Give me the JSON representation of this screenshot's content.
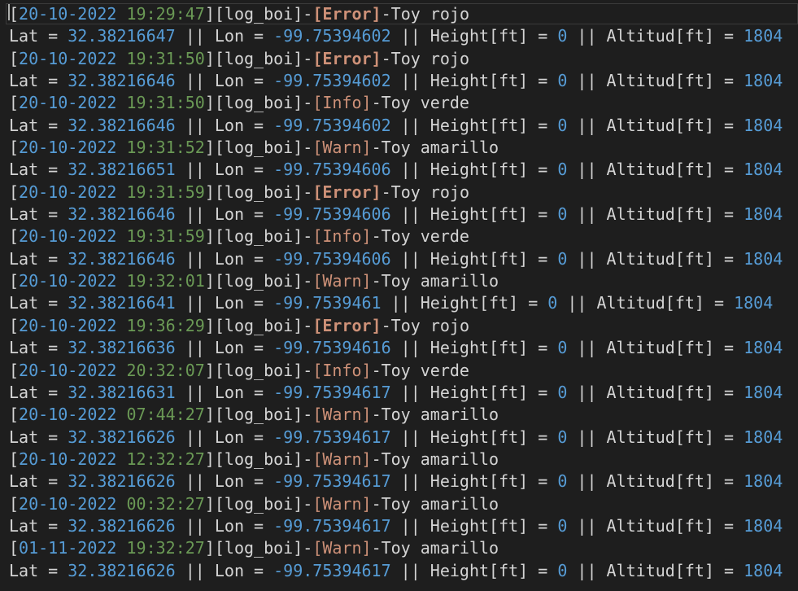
{
  "colors": {
    "background": "#1e1e1e",
    "text": "#d4d4d4",
    "date": "#569cd6",
    "time": "#6a9955",
    "number": "#569cd6",
    "level": "#ce9178",
    "current_line_border": "#3a3a3a",
    "cursor": "#aeafad"
  },
  "log": [
    {
      "header": {
        "date": "20-10-2022",
        "time": "19:29:47",
        "source": "[log_boi]",
        "level": "[Error]",
        "message": "-Toy rojo"
      },
      "data": {
        "lat_label": "Lat = ",
        "lat": "32.38216647",
        "lon_label": " || Lon = ",
        "lon": "-99.75394602",
        "height_label": " || Height[ft] = ",
        "height": "0",
        "alt_label": " || Altitud[ft] = ",
        "alt": "1804"
      }
    },
    {
      "header": {
        "date": "20-10-2022",
        "time": "19:31:50",
        "source": "[log_boi]",
        "level": "[Error]",
        "message": "-Toy rojo"
      },
      "data": {
        "lat_label": "Lat = ",
        "lat": "32.38216646",
        "lon_label": " || Lon = ",
        "lon": "-99.75394602",
        "height_label": " || Height[ft] = ",
        "height": "0",
        "alt_label": " || Altitud[ft] = ",
        "alt": "1804"
      }
    },
    {
      "header": {
        "date": "20-10-2022",
        "time": "19:31:50",
        "source": "[log_boi]",
        "level": "[Info]",
        "message": "-Toy verde"
      },
      "data": {
        "lat_label": "Lat = ",
        "lat": "32.38216646",
        "lon_label": " || Lon = ",
        "lon": "-99.75394602",
        "height_label": " || Height[ft] = ",
        "height": "0",
        "alt_label": " || Altitud[ft] = ",
        "alt": "1804"
      }
    },
    {
      "header": {
        "date": "20-10-2022",
        "time": "19:31:52",
        "source": "[log_boi]",
        "level": "[Warn]",
        "message": "-Toy amarillo"
      },
      "data": {
        "lat_label": "Lat = ",
        "lat": "32.38216651",
        "lon_label": " || Lon = ",
        "lon": "-99.75394606",
        "height_label": " || Height[ft] = ",
        "height": "0",
        "alt_label": " || Altitud[ft] = ",
        "alt": "1804"
      }
    },
    {
      "header": {
        "date": "20-10-2022",
        "time": "19:31:59",
        "source": "[log_boi]",
        "level": "[Error]",
        "message": "-Toy rojo"
      },
      "data": {
        "lat_label": "Lat = ",
        "lat": "32.38216646",
        "lon_label": " || Lon = ",
        "lon": "-99.75394606",
        "height_label": " || Height[ft] = ",
        "height": "0",
        "alt_label": " || Altitud[ft] = ",
        "alt": "1804"
      }
    },
    {
      "header": {
        "date": "20-10-2022",
        "time": "19:31:59",
        "source": "[log_boi]",
        "level": "[Info]",
        "message": "-Toy verde"
      },
      "data": {
        "lat_label": "Lat = ",
        "lat": "32.38216646",
        "lon_label": " || Lon = ",
        "lon": "-99.75394606",
        "height_label": " || Height[ft] = ",
        "height": "0",
        "alt_label": " || Altitud[ft] = ",
        "alt": "1804"
      }
    },
    {
      "header": {
        "date": "20-10-2022",
        "time": "19:32:01",
        "source": "[log_boi]",
        "level": "[Warn]",
        "message": "-Toy amarillo"
      },
      "data": {
        "lat_label": "Lat = ",
        "lat": "32.38216641",
        "lon_label": " || Lon = ",
        "lon": "-99.7539461",
        "height_label": " || Height[ft] = ",
        "height": "0",
        "alt_label": " || Altitud[ft] = ",
        "alt": "1804"
      }
    },
    {
      "header": {
        "date": "20-10-2022",
        "time": "19:36:29",
        "source": "[log_boi]",
        "level": "[Error]",
        "message": "-Toy rojo"
      },
      "data": {
        "lat_label": "Lat = ",
        "lat": "32.38216636",
        "lon_label": " || Lon = ",
        "lon": "-99.75394616",
        "height_label": " || Height[ft] = ",
        "height": "0",
        "alt_label": " || Altitud[ft] = ",
        "alt": "1804"
      }
    },
    {
      "header": {
        "date": "20-10-2022",
        "time": "20:32:07",
        "source": "[log_boi]",
        "level": "[Info]",
        "message": "-Toy verde"
      },
      "data": {
        "lat_label": "Lat = ",
        "lat": "32.38216631",
        "lon_label": " || Lon = ",
        "lon": "-99.75394617",
        "height_label": " || Height[ft] = ",
        "height": "0",
        "alt_label": " || Altitud[ft] = ",
        "alt": "1804"
      }
    },
    {
      "header": {
        "date": "20-10-2022",
        "time": "07:44:27",
        "source": "[log_boi]",
        "level": "[Warn]",
        "message": "-Toy amarillo"
      },
      "data": {
        "lat_label": "Lat = ",
        "lat": "32.38216626",
        "lon_label": " || Lon = ",
        "lon": "-99.75394617",
        "height_label": " || Height[ft] = ",
        "height": "0",
        "alt_label": " || Altitud[ft] = ",
        "alt": "1804"
      }
    },
    {
      "header": {
        "date": "20-10-2022",
        "time": "12:32:27",
        "source": "[log_boi]",
        "level": "[Warn]",
        "message": "-Toy amarillo"
      },
      "data": {
        "lat_label": "Lat = ",
        "lat": "32.38216626",
        "lon_label": " || Lon = ",
        "lon": "-99.75394617",
        "height_label": " || Height[ft] = ",
        "height": "0",
        "alt_label": " || Altitud[ft] = ",
        "alt": "1804"
      }
    },
    {
      "header": {
        "date": "20-10-2022",
        "time": "00:32:27",
        "source": "[log_boi]",
        "level": "[Warn]",
        "message": "-Toy amarillo"
      },
      "data": {
        "lat_label": "Lat = ",
        "lat": "32.38216626",
        "lon_label": " || Lon = ",
        "lon": "-99.75394617",
        "height_label": " || Height[ft] = ",
        "height": "0",
        "alt_label": " || Altitud[ft] = ",
        "alt": "1804"
      }
    },
    {
      "header": {
        "date": "01-11-2022",
        "time": "19:32:27",
        "source": "[log_boi]",
        "level": "[Warn]",
        "message": "-Toy amarillo"
      },
      "data": {
        "lat_label": "Lat = ",
        "lat": "32.38216626",
        "lon_label": " || Lon = ",
        "lon": "-99.75394617",
        "height_label": " || Height[ft] = ",
        "height": "0",
        "alt_label": " || Altitud[ft] = ",
        "alt": "1804"
      }
    }
  ]
}
